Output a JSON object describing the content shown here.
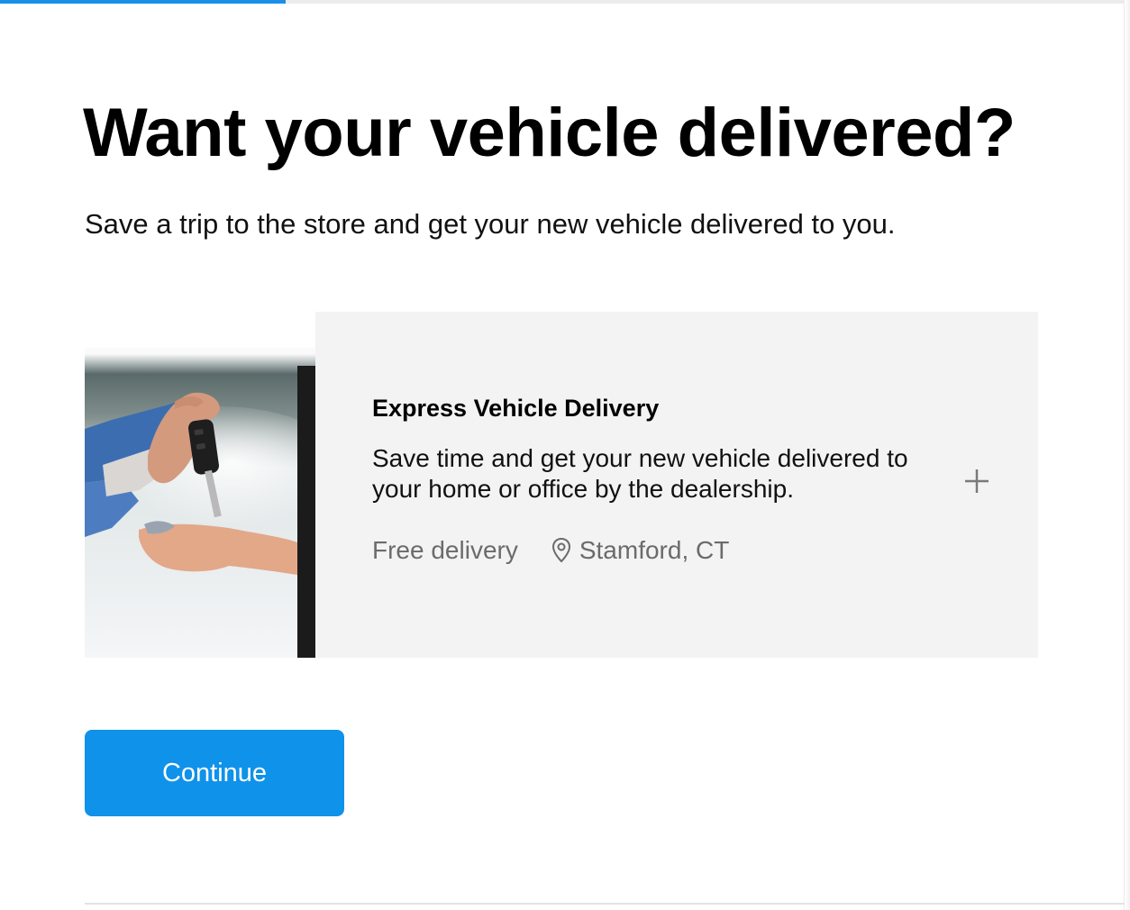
{
  "progress": {
    "fraction": 0.254
  },
  "header": {
    "title": "Want your vehicle delivered?",
    "subtitle": "Save a trip to the store and get your new vehicle delivered to you."
  },
  "delivery_card": {
    "image_icon": "hand-giving-car-keys-photo",
    "title": "Express Vehicle Delivery",
    "description": "Save time and get your new vehicle delivered to your home or office by the dealership.",
    "price_label": "Free delivery",
    "location_icon": "location-pin-icon",
    "location": "Stamford, CT",
    "expand_icon": "plus-icon"
  },
  "actions": {
    "continue_label": "Continue"
  },
  "colors": {
    "accent": "#0f92ea",
    "card_background": "#f3f3f3",
    "meta_text": "#6b6b6b"
  }
}
